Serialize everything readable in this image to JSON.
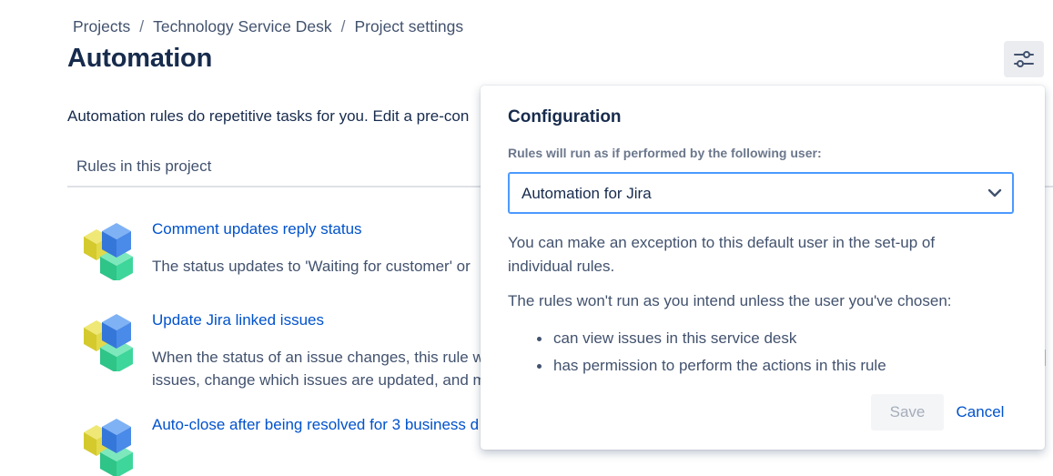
{
  "breadcrumb": {
    "items": [
      "Projects",
      "Technology Service Desk",
      "Project settings"
    ],
    "separator": "/"
  },
  "page": {
    "title": "Automation",
    "intro": "Automation rules do repetitive tasks for you. Edit a pre-con",
    "section_header": "Rules in this project"
  },
  "header_actions": {
    "settings_icon": "sliders-icon"
  },
  "rules": [
    {
      "title": "Comment updates reply status",
      "description_lines": [
        "The status updates to 'Waiting for customer' or"
      ],
      "icon": "cube-cluster-icon"
    },
    {
      "title": "Update Jira linked issues",
      "description_lines": [
        "When the status of an issue changes, this rule w",
        "issues, change which issues are updated, and m"
      ],
      "icon": "cube-cluster-icon"
    },
    {
      "title": "Auto-close after being resolved for 3 business d",
      "description_lines": [],
      "icon": "cube-cluster-icon"
    }
  ],
  "config": {
    "title": "Configuration",
    "field_label": "Rules will run as if performed by the following user:",
    "selected_user": "Automation for Jira",
    "exception_text": "You can make an exception to this default user in the set-up of individual rules.",
    "warning_text": "The rules won't run as you intend unless the user you've chosen:",
    "conditions": [
      "can view issues in this service desk",
      "has permission to perform the actions in this rule"
    ],
    "save_label": "Save",
    "cancel_label": "Cancel"
  },
  "colors": {
    "link": "#0052cc",
    "text_primary": "#172b4d",
    "text_secondary": "#42526e",
    "focus_border": "#4c9aff",
    "cube_yellow": "#e2d94b",
    "cube_blue": "#4a8ae8",
    "cube_green": "#3ed69a"
  }
}
